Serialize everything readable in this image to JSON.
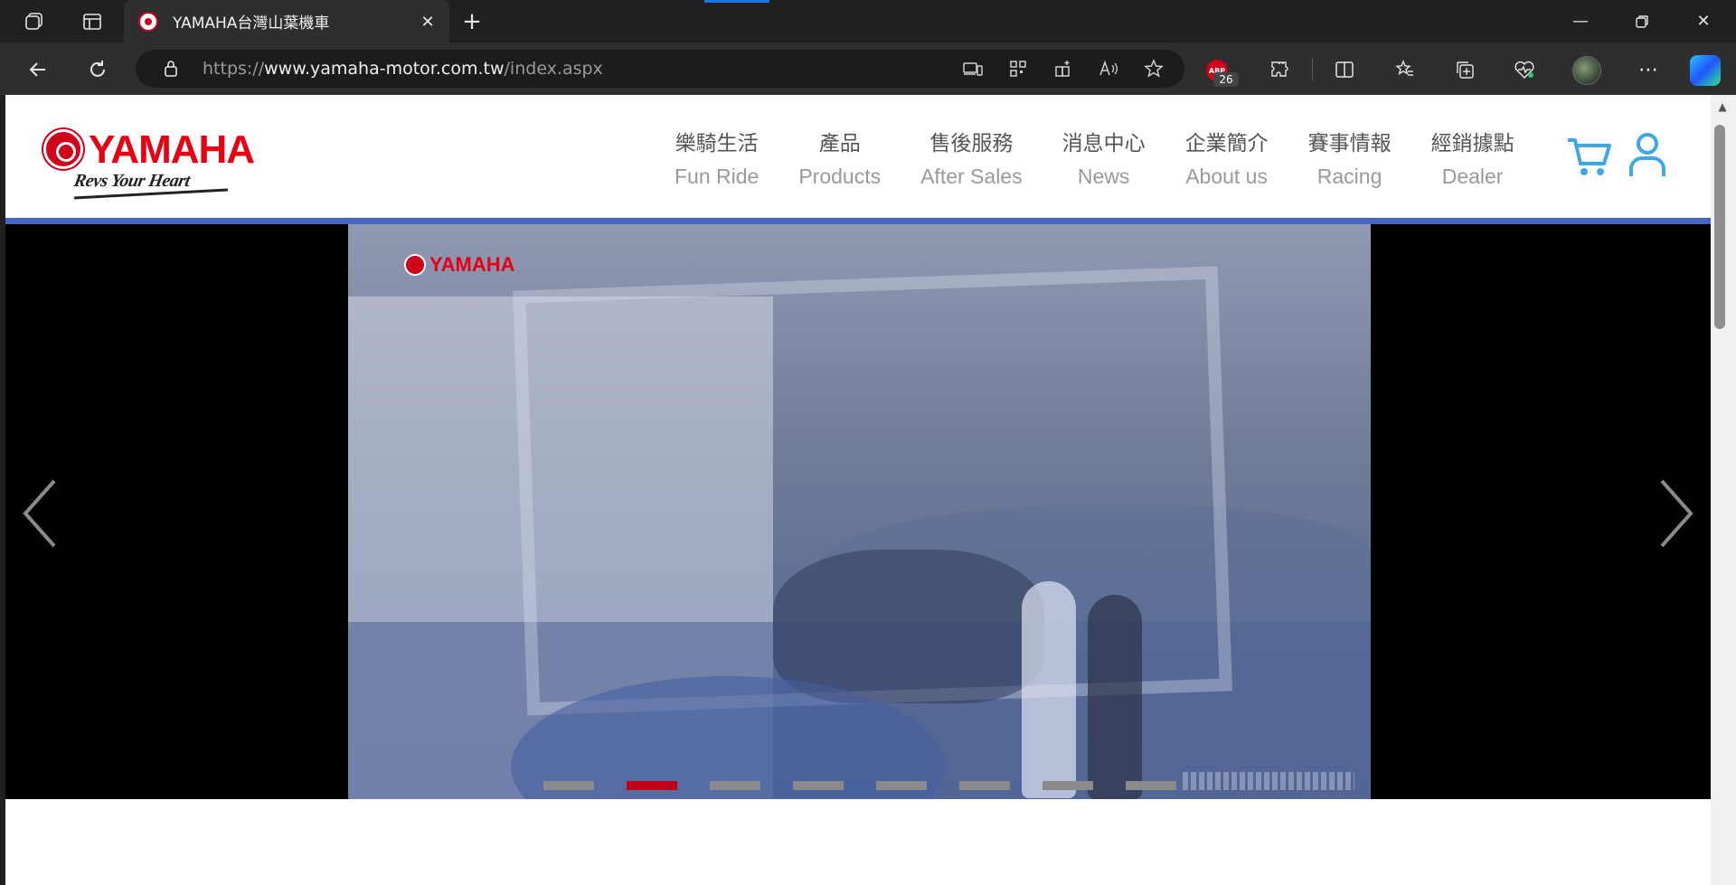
{
  "browser": {
    "tab_title": "YAMAHA台灣山葉機車",
    "url_scheme": "https://",
    "url_host": "www.yamaha-motor.com.tw",
    "url_path": "/index.aspx",
    "abp_label": "ABP",
    "abp_count": "26",
    "accent_color": "#1a73e8"
  },
  "site": {
    "brand": "YAMAHA",
    "tagline": "Revs Your Heart",
    "brand_color": "#e60012",
    "rule_color": "#4566c2",
    "menu": [
      {
        "zh": "樂騎生活",
        "en": "Fun Ride"
      },
      {
        "zh": "產品",
        "en": "Products"
      },
      {
        "zh": "售後服務",
        "en": "After Sales"
      },
      {
        "zh": "消息中心",
        "en": "News"
      },
      {
        "zh": "企業簡介",
        "en": "About us"
      },
      {
        "zh": "賽事情報",
        "en": "Racing"
      },
      {
        "zh": "經銷據點",
        "en": "Dealer"
      }
    ],
    "icon_color": "#3ea8e6"
  },
  "slider": {
    "watermark": "YAMAHA",
    "slide_count": 8,
    "active_index": 1,
    "active_color": "#c00014"
  }
}
